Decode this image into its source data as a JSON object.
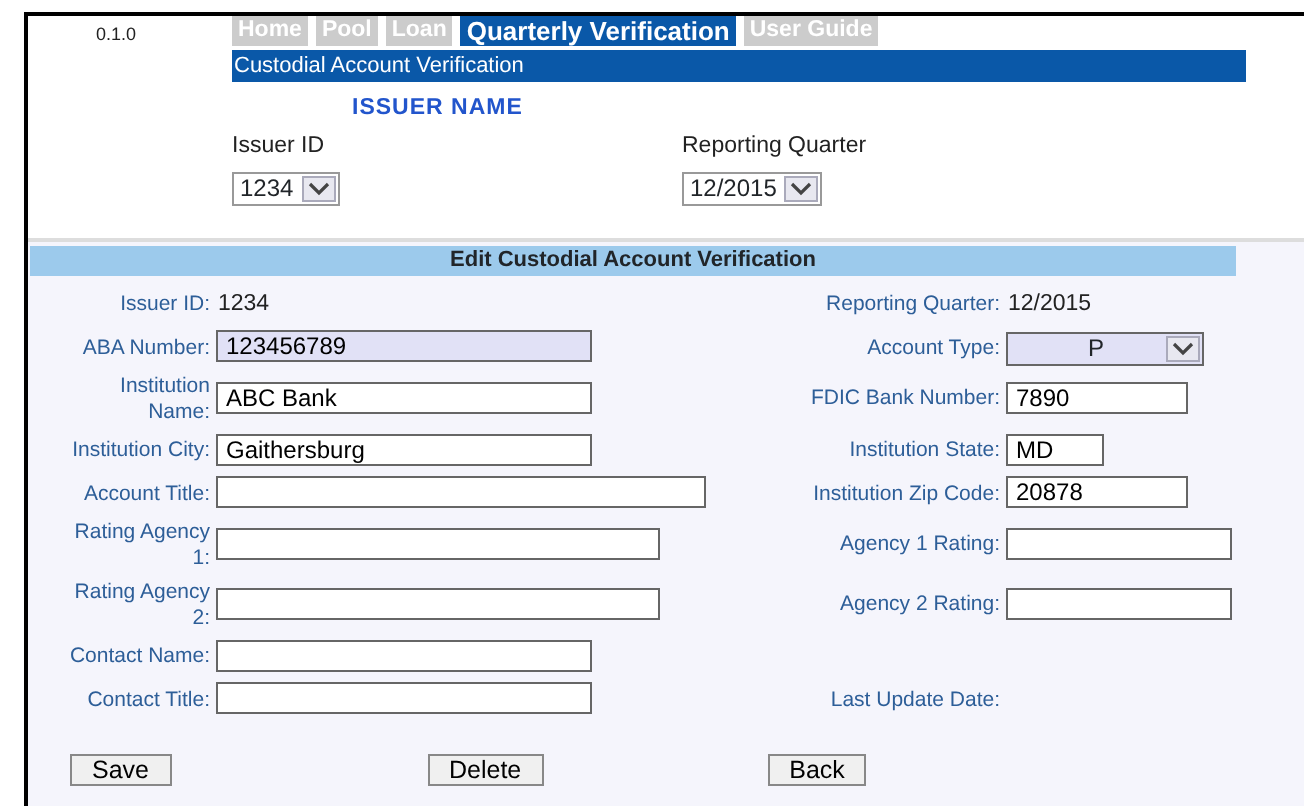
{
  "version": "0.1.0",
  "tabs": [
    {
      "label": "Home",
      "selected": false
    },
    {
      "label": "Pool",
      "selected": false
    },
    {
      "label": "Loan",
      "selected": false
    },
    {
      "label": "Quarterly Verification",
      "selected": true
    },
    {
      "label": "User Guide",
      "selected": false
    }
  ],
  "page_title": "Custodial Account Verification",
  "issuer_name": "ISSUER NAME",
  "filters": [
    {
      "label": "Issuer ID",
      "value": "1234"
    },
    {
      "label": "Reporting Quarter",
      "value": "12/2015"
    }
  ],
  "form": {
    "title": "Edit Custodial Account Verification",
    "rows": [
      {
        "left": {
          "label": "Issuer ID:",
          "kind": "text",
          "value": "1234"
        },
        "right": {
          "label": "Reporting Quarter:",
          "kind": "text",
          "value": "12/2015"
        }
      },
      {
        "left": {
          "label": "ABA Number:",
          "kind": "input",
          "value": "123456789",
          "highlighted": true
        },
        "right": {
          "label": "Account Type:",
          "kind": "select",
          "value": "P",
          "highlighted": true
        }
      },
      {
        "left": {
          "label": "Institution Name:",
          "kind": "input",
          "value": "ABC Bank",
          "highlighted": false
        },
        "right": {
          "label": "FDIC Bank Number:",
          "kind": "input",
          "value": "7890",
          "highlighted": false
        }
      },
      {
        "left": {
          "label": "Institution City:",
          "kind": "input",
          "value": "Gaithersburg",
          "highlighted": false
        },
        "right": {
          "label": "Institution State:",
          "kind": "input",
          "value": "MD",
          "highlighted": false
        }
      },
      {
        "left": {
          "label": "Account Title:",
          "kind": "input",
          "highlighted": false
        },
        "right": {
          "label": "Institution Zip Code:",
          "kind": "input",
          "value": "20878",
          "highlighted": false
        }
      },
      {
        "left": {
          "label": "Rating Agency 1:",
          "kind": "input",
          "highlighted": false
        },
        "right": {
          "label": "Agency 1 Rating:",
          "kind": "input",
          "highlighted": false
        }
      },
      {
        "left": {
          "label": "Rating Agency 2:",
          "kind": "input",
          "highlighted": false
        },
        "right": {
          "label": "Agency 2 Rating:",
          "kind": "input",
          "highlighted": false
        }
      },
      {
        "left": {
          "label": "Contact Name:",
          "kind": "input",
          "highlighted": false
        }
      },
      {
        "left": {
          "label": "Contact Title:",
          "kind": "input",
          "highlighted": false
        },
        "right": {
          "label": "Last Update Date:",
          "kind": "text"
        }
      }
    ]
  },
  "buttons": [
    "Save",
    "Delete",
    "Back"
  ]
}
